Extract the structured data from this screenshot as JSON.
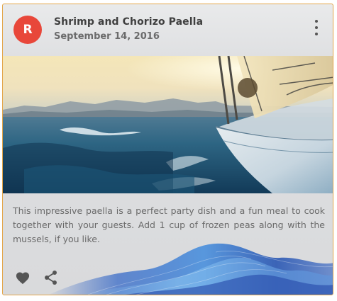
{
  "card": {
    "avatar_letter": "R",
    "title": "Shrimp and Chorizo Paella",
    "subheader": "September 14, 2016",
    "body": "This impressive paella is a perfect party dish and a fun meal to cook together with your guests. Add 1 cup of frozen peas along with the mussels, if you like."
  },
  "colors": {
    "avatar": "#e8473a",
    "border": "#e3a64a",
    "icon": "#555555"
  },
  "icons": {
    "more": "more-vert-icon",
    "favorite": "heart-icon",
    "share": "share-icon"
  }
}
